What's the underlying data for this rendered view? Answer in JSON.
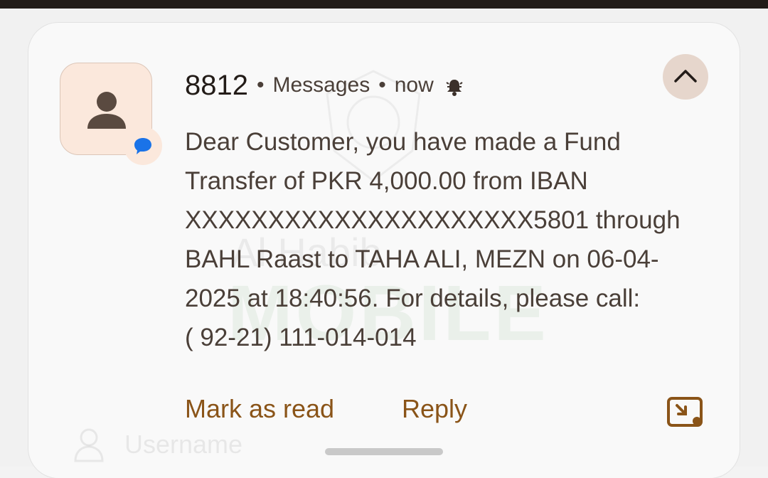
{
  "notification": {
    "sender": "8812",
    "separator": "•",
    "app_name": "Messages",
    "time": "now",
    "bell_icon": "bell-ringing-icon",
    "avatar_icon": "person-icon",
    "app_badge_icon": "chat-bubble-icon",
    "collapse_icon": "chevron-up-icon",
    "message": "Dear Customer, you have made a Fund\nTransfer of PKR 4,000.00 from IBAN\nXXXXXXXXXXXXXXXXXXXXX5801 through\nBAHL Raast to TAHA ALI, MEZN on 06-04-\n2025 at 18:40:56. For details, please call:\n( 92-21) 111-014-014",
    "actions": {
      "mark_as_read": "Mark as read",
      "reply": "Reply"
    },
    "expand_icon": "picture-in-picture-icon"
  },
  "background": {
    "watermark_title": "Al Habib",
    "watermark_brand": "MOBILE",
    "username_placeholder": "Username"
  },
  "colors": {
    "accent": "#8a5418",
    "avatar_bg": "#fbe8dc",
    "badge_blue": "#1a73e8",
    "collapse_bg": "#e6d6cc"
  }
}
